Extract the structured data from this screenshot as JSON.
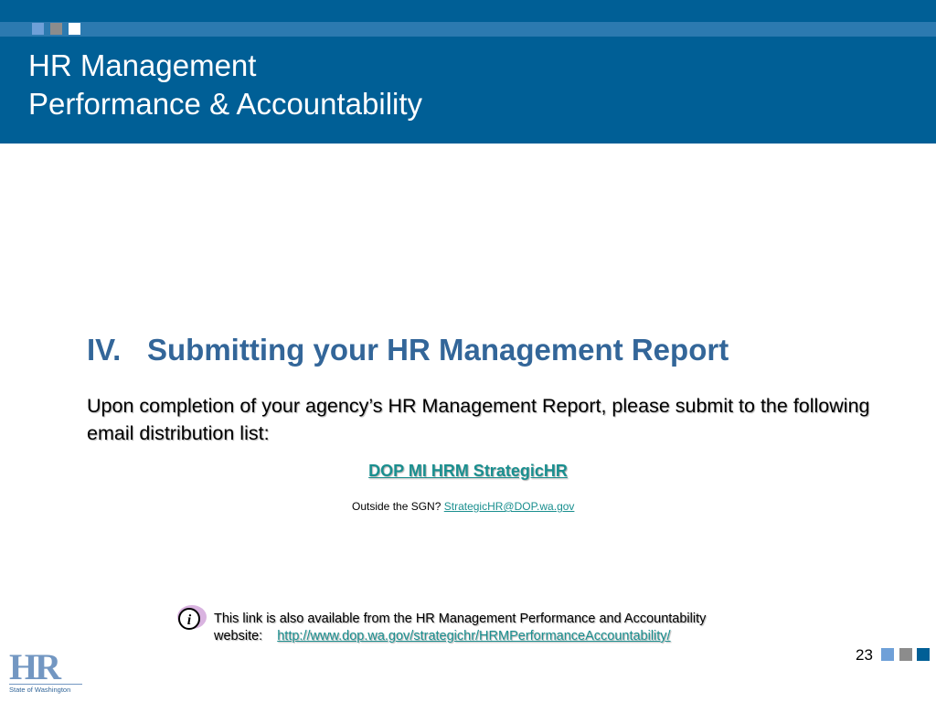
{
  "header": {
    "title_line1": "HR Management",
    "title_line2": "Performance & Accountability",
    "square_colors": [
      "#6fa0d8",
      "#8c8c8c",
      "#ffffff"
    ]
  },
  "section": {
    "number": "IV.",
    "heading": "Submitting your HR Management Report"
  },
  "body": {
    "paragraph": "Upon completion of your agency’s HR Management Report, please submit to the following email distribution list:"
  },
  "distribution": {
    "link_text": "DOP MI HRM StrategicHR"
  },
  "outside": {
    "label": "Outside the SGN?",
    "email": "StrategicHR@DOP.wa.gov"
  },
  "info": {
    "icon": "info-icon",
    "line1": "This link is also available from the HR Management Performance and Accountability",
    "line2_label": "website:",
    "url": "http://www.dop.wa.gov/strategichr/HRMPerformanceAccountability/"
  },
  "footer": {
    "logo_text": "HR",
    "logo_subtitle": "State of Washington",
    "page_number": "23",
    "square_colors": [
      "#6fa0d8",
      "#8c8c8c",
      "#005f96"
    ]
  },
  "colors": {
    "header_blue": "#005f96",
    "heading_blue": "#336699",
    "link_teal": "#1a8f8f"
  }
}
